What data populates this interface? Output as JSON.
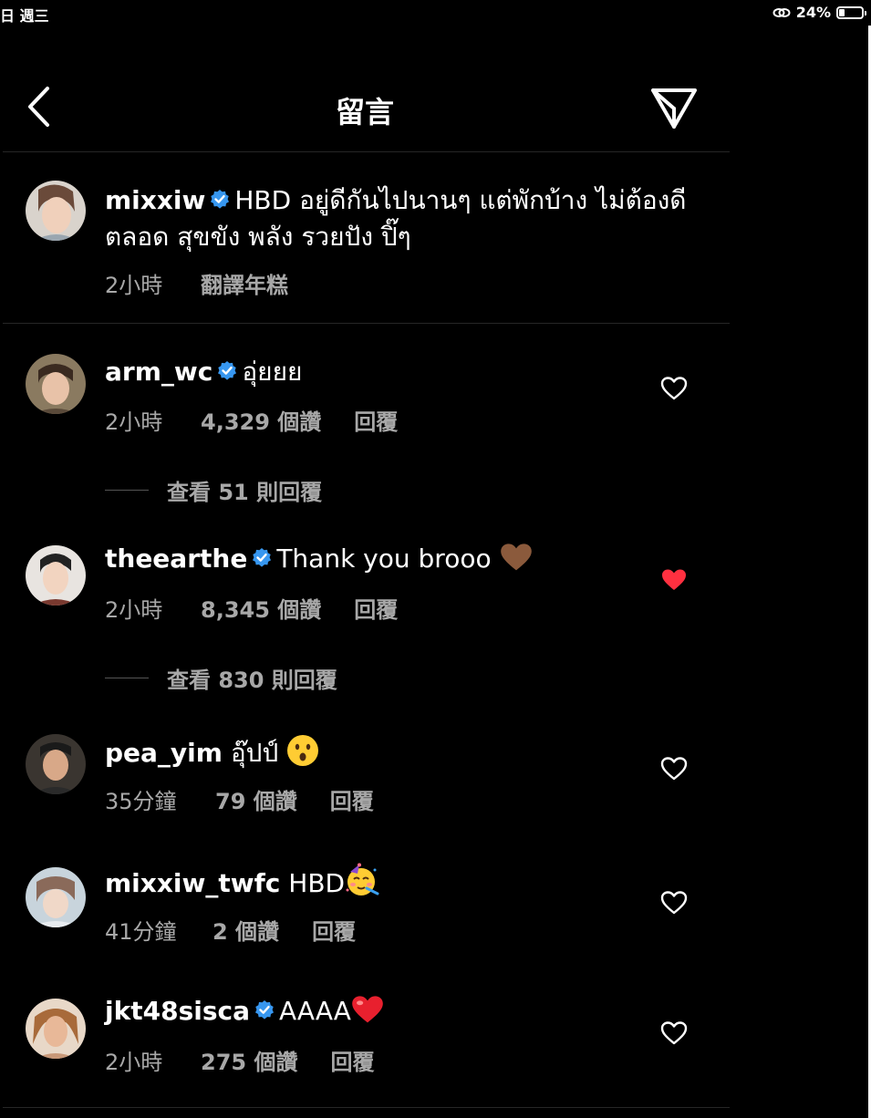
{
  "status_bar": {
    "left_text": "日 週三",
    "battery_text": "24%",
    "battery_level": 0.24
  },
  "header": {
    "title": "留言"
  },
  "caption": {
    "username": "mixxiw",
    "verified": true,
    "text_line1": "HBD อยู่ดีกันไปนานๆ แต่พักบ้าง ไม่ต้องดี",
    "text_line2": "ตลอด สุขขัง พลัง รวยปัง ปิ๊ๆ",
    "time": "2小時",
    "translate_label": "翻譯年糕"
  },
  "comments": [
    {
      "username": "arm_wc",
      "verified": true,
      "text": "อุ่ยยย",
      "time": "2小時",
      "likes": "4,329 個讚",
      "reply_label": "回覆",
      "liked": false,
      "view_replies": "查看 51 則回覆"
    },
    {
      "username": "theearthe",
      "verified": true,
      "text": "Thank you brooo",
      "time": "2小時",
      "likes": "8,345 個讚",
      "reply_label": "回覆",
      "liked": true,
      "view_replies": "查看 830 則回覆"
    },
    {
      "username": "pea_yim",
      "verified": false,
      "text": "อุ๊ปป์",
      "time": "35分鐘",
      "likes": "79 個讚",
      "reply_label": "回覆",
      "liked": false
    },
    {
      "username": "mixxiw_twfc",
      "verified": false,
      "text": "HBD",
      "time": "41分鐘",
      "likes": "2 個讚",
      "reply_label": "回覆",
      "liked": false
    },
    {
      "username": "jkt48sisca",
      "verified": true,
      "text": "AAAA",
      "time": "2小時",
      "likes": "275 個讚",
      "reply_label": "回覆",
      "liked": false
    }
  ],
  "colors": {
    "background": "#000000",
    "verified": "#3797f0",
    "liked_heart": "#ff3040",
    "meta_text": "#a8a8a8"
  }
}
